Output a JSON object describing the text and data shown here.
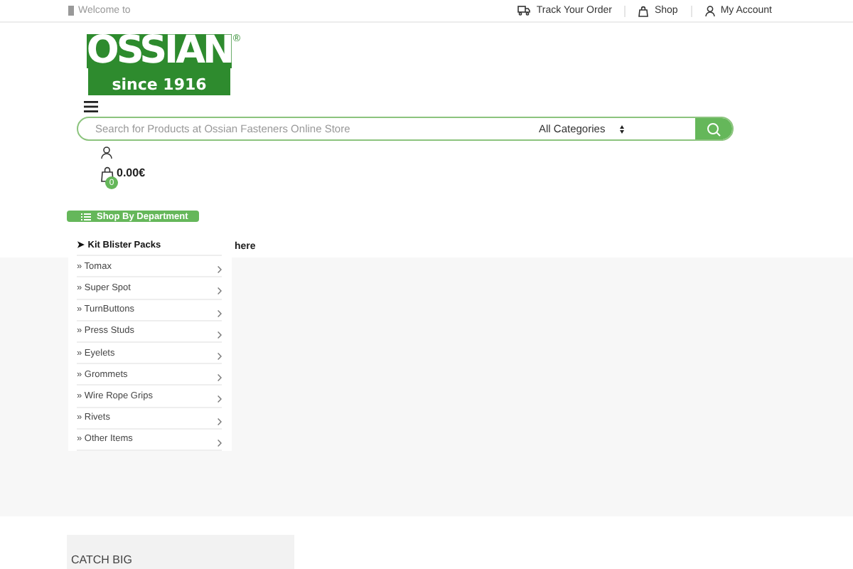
{
  "top_bar": {
    "welcome": "Welcome to",
    "links": [
      {
        "label": "Track Your Order",
        "kind": "truck"
      },
      {
        "label": "Shop",
        "kind": "bag"
      },
      {
        "label": "My Account",
        "kind": "user"
      }
    ]
  },
  "logo": {
    "name": "OSSIAN",
    "mark": "®",
    "tagline": "since 1916"
  },
  "search": {
    "placeholder": "Search for Products at Ossian Fasteners Online Store",
    "category": "All Categories"
  },
  "cart": {
    "total": "0.00€",
    "count": "0"
  },
  "department": {
    "title": "Shop By Department",
    "items": [
      {
        "label": "➤ Kit Blister Packs",
        "selected": true
      },
      {
        "label": "» Tomax",
        "selected": false
      },
      {
        "label": "» Super Spot",
        "selected": false
      },
      {
        "label": "» TurnButtons",
        "selected": false
      },
      {
        "label": "» Press Studs",
        "selected": false
      },
      {
        "label": "» Eyelets",
        "selected": false
      },
      {
        "label": "» Grommets",
        "selected": false
      },
      {
        "label": "» Wire Rope Grips",
        "selected": false
      },
      {
        "label": "» Rivets",
        "selected": false
      },
      {
        "label": "» Other Items",
        "selected": false
      }
    ]
  },
  "hero_text": "here",
  "promo": {
    "title": "CATCH BIG"
  }
}
